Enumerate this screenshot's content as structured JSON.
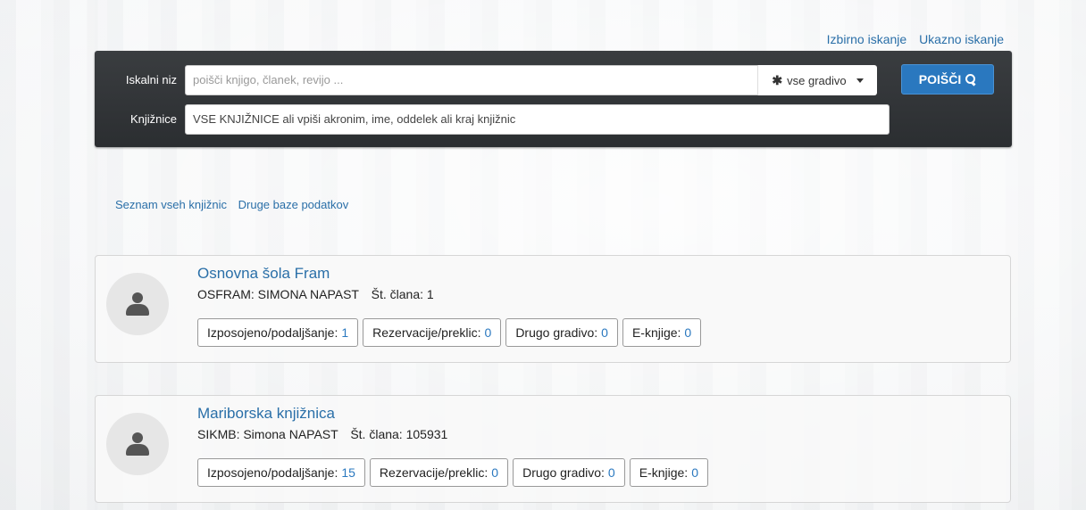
{
  "top_links": {
    "selective_search": "Izbirno iskanje",
    "command_search": "Ukazno iskanje"
  },
  "search": {
    "query_label": "Iskalni niz",
    "query_placeholder": "poišči knjigo, članek, revijo ...",
    "material_select": "vse gradivo",
    "search_button": "POIŠČI",
    "libraries_label": "Knjižnice",
    "libraries_value": "VSE KNJIŽNICE ali vpiši akronim, ime, oddelek ali kraj knjižnic"
  },
  "links": {
    "all_libraries": "Seznam vseh knjižnic",
    "other_databases": "Druge baze podatkov"
  },
  "cards": [
    {
      "library": "Osnovna šola Fram",
      "member": "OSFRAM: SIMONA NAPAST",
      "member_no_label": "Št. člana:",
      "member_no": "1",
      "stats": [
        {
          "label": "Izposojeno/podaljšanje:",
          "value": "1"
        },
        {
          "label": "Rezervacije/preklic:",
          "value": "0"
        },
        {
          "label": "Drugo gradivo:",
          "value": "0"
        },
        {
          "label": "E-knjige:",
          "value": "0"
        }
      ]
    },
    {
      "library": "Mariborska knjižnica",
      "member": "SIKMB: Simona NAPAST",
      "member_no_label": "Št. člana:",
      "member_no": "105931",
      "stats": [
        {
          "label": "Izposojeno/podaljšanje:",
          "value": "15"
        },
        {
          "label": "Rezervacije/preklic:",
          "value": "0"
        },
        {
          "label": "Drugo gradivo:",
          "value": "0"
        },
        {
          "label": "E-knjige:",
          "value": "0"
        }
      ]
    }
  ],
  "colors": {
    "link": "#2a6fa8",
    "button": "#2a78bf",
    "panel": "#2f3235"
  }
}
